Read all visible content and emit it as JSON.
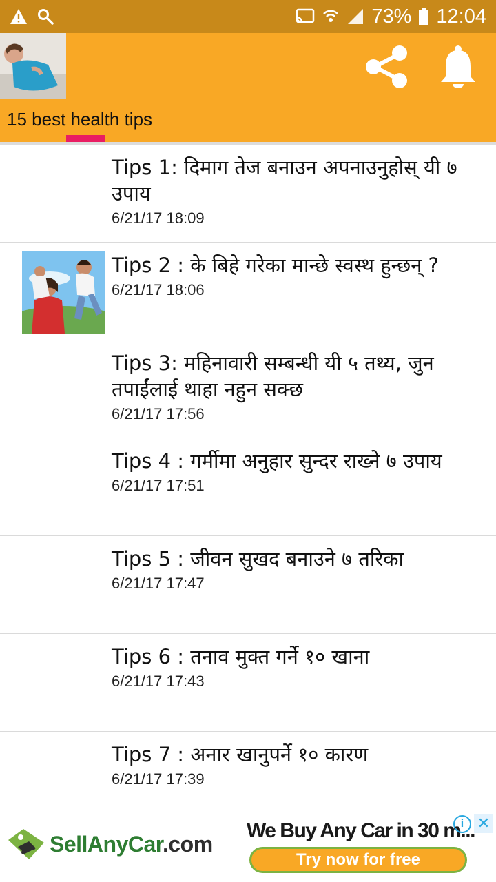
{
  "status_bar": {
    "battery": "73%",
    "time": "12:04",
    "icons": [
      "warning-icon",
      "search-icon",
      "cast-icon",
      "wifi-icon",
      "signal-icon",
      "battery-icon"
    ]
  },
  "app_bar": {
    "tab_label": "15 best health tips",
    "accent_color": "#f9a825",
    "indicator_color": "#e91e63",
    "actions": [
      "share-icon",
      "bell-icon"
    ]
  },
  "list": {
    "items": [
      {
        "title": "Tips 1: दिमाग तेज बनाउन अपनाउनुहोस् यी ७ उपाय",
        "date": "6/21/17 18:09",
        "has_image": false
      },
      {
        "title": "Tips 2 : के बिहे गरेका मान्छे स्वस्थ हुन्छन् ?",
        "date": "6/21/17 18:06",
        "has_image": true
      },
      {
        "title": "Tips 3: महिनावारी सम्बन्धी यी ५ तथ्य, जुन तपाईंलाई थाहा नहुन सक्छ",
        "date": "6/21/17 17:56",
        "has_image": false
      },
      {
        "title": "Tips 4 : गर्मीमा अनुहार सुन्दर राख्ने ७ उपाय",
        "date": "6/21/17 17:51",
        "has_image": false
      },
      {
        "title": "Tips 5 : जीवन सुखद बनाउने ७ तरिका",
        "date": "6/21/17 17:47",
        "has_image": false
      },
      {
        "title": "Tips 6 : तनाव मुक्त गर्ने १० खाना",
        "date": "6/21/17 17:43",
        "has_image": false
      },
      {
        "title": "Tips 7 : अनार खानुपर्ने १० कारण",
        "date": "6/21/17 17:39",
        "has_image": false
      }
    ]
  },
  "ad": {
    "brand_part1": "SellAny",
    "brand_part2": "Car",
    "brand_part3": ".com",
    "headline": "We Buy Any Car in 30 m...",
    "cta": "Try now for free",
    "info_symbol": "i",
    "close_symbol": "✕"
  }
}
